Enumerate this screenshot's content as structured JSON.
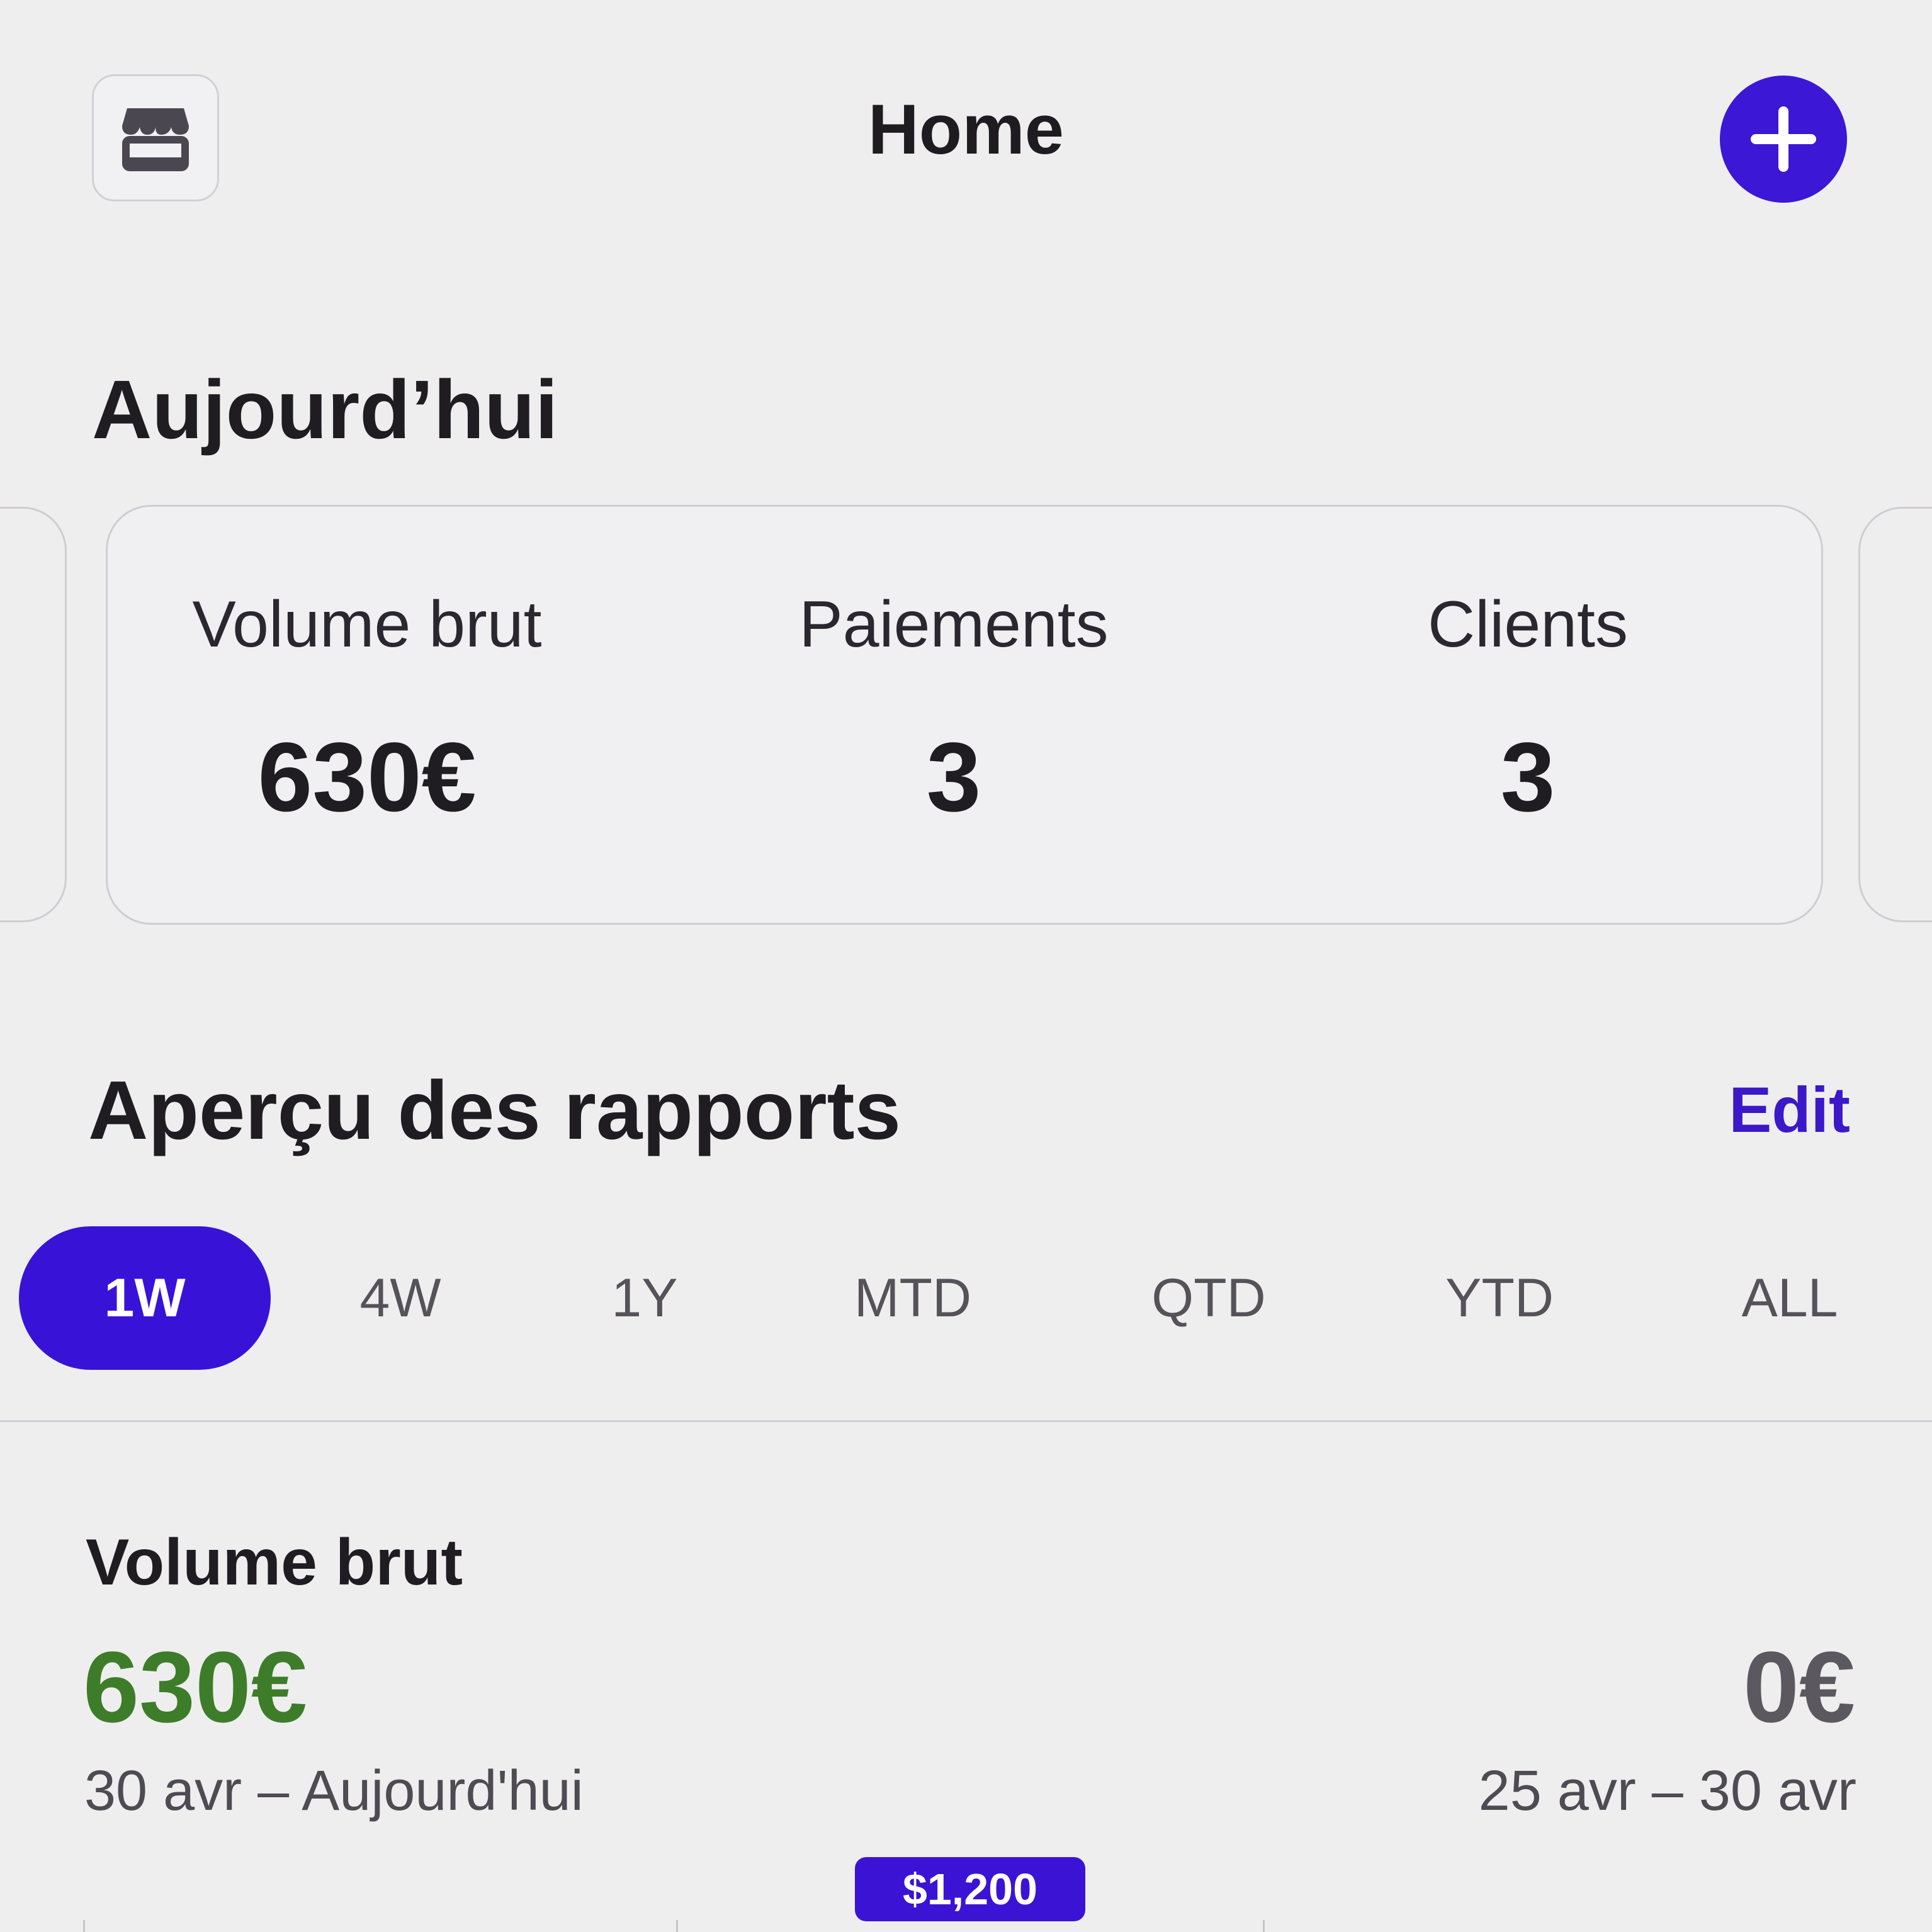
{
  "header": {
    "title": "Home",
    "left_icon": "storefront-icon",
    "right_icon": "plus-icon"
  },
  "today": {
    "heading": "Aujourd’hui",
    "stats": [
      {
        "label": "Volume brut",
        "value": "630€"
      },
      {
        "label": "Paiements",
        "value": "3"
      },
      {
        "label": "Clients",
        "value": "3"
      }
    ]
  },
  "reports": {
    "heading": "Aperçu des rapports",
    "edit_label": "Edit",
    "periods": [
      "1W",
      "4W",
      "1Y",
      "MTD",
      "QTD",
      "YTD",
      "ALL"
    ],
    "active_period": "1W",
    "metric": {
      "title": "Volume brut",
      "current_value": "630€",
      "current_range": "30 avr – Aujourd'hui",
      "previous_value": "0€",
      "previous_range": "25 avr – 30 avr"
    },
    "chart_tooltip": "$1,200"
  },
  "colors": {
    "accent": "#3c17d6",
    "positive": "#3d7d2a",
    "background": "#efeeef"
  }
}
